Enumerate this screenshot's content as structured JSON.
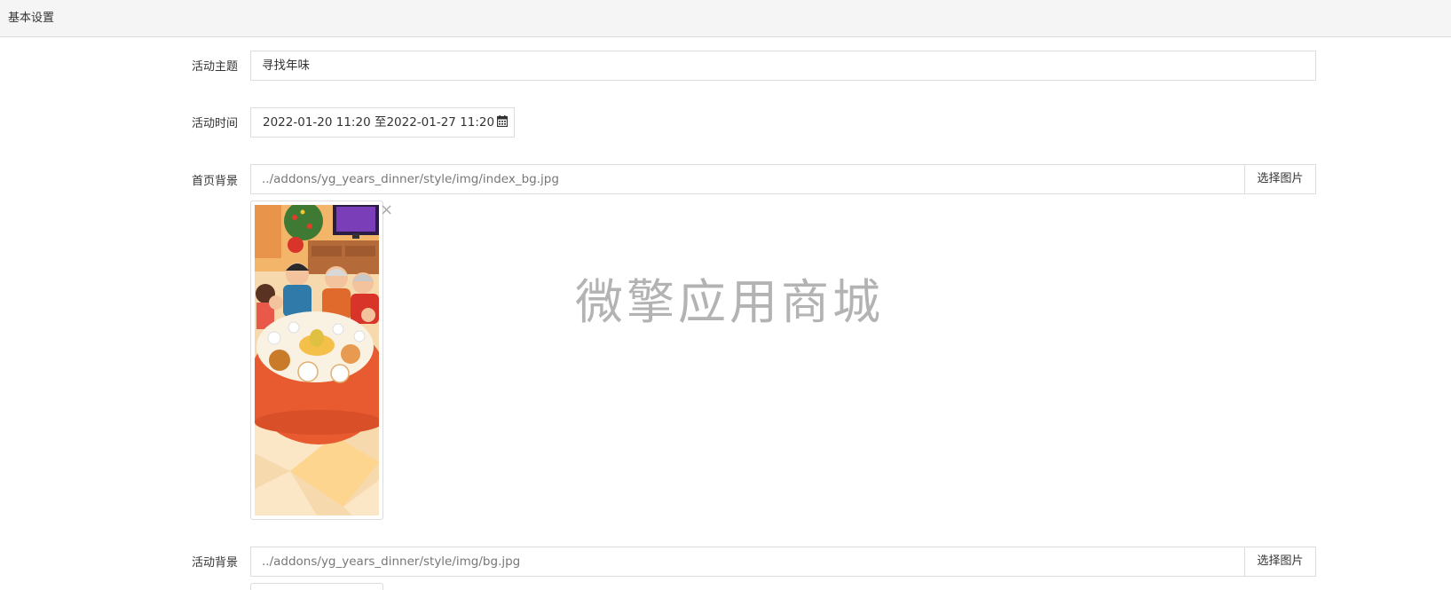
{
  "header": {
    "title": "基本设置"
  },
  "form": {
    "theme": {
      "label": "活动主题",
      "value": "寻找年味"
    },
    "time": {
      "label": "活动时间",
      "value": "2022-01-20 11:20 至2022-01-27 11:20"
    },
    "home_bg": {
      "label": "首页背景",
      "value": "../addons/yg_years_dinner/style/img/index_bg.jpg",
      "button": "选择图片",
      "remove": "×"
    },
    "activity_bg": {
      "label": "活动背景",
      "value": "../addons/yg_years_dinner/style/img/bg.jpg",
      "button": "选择图片"
    }
  },
  "watermark": "微擎应用商城",
  "icons": [
    "calendar-icon",
    "close-icon"
  ]
}
